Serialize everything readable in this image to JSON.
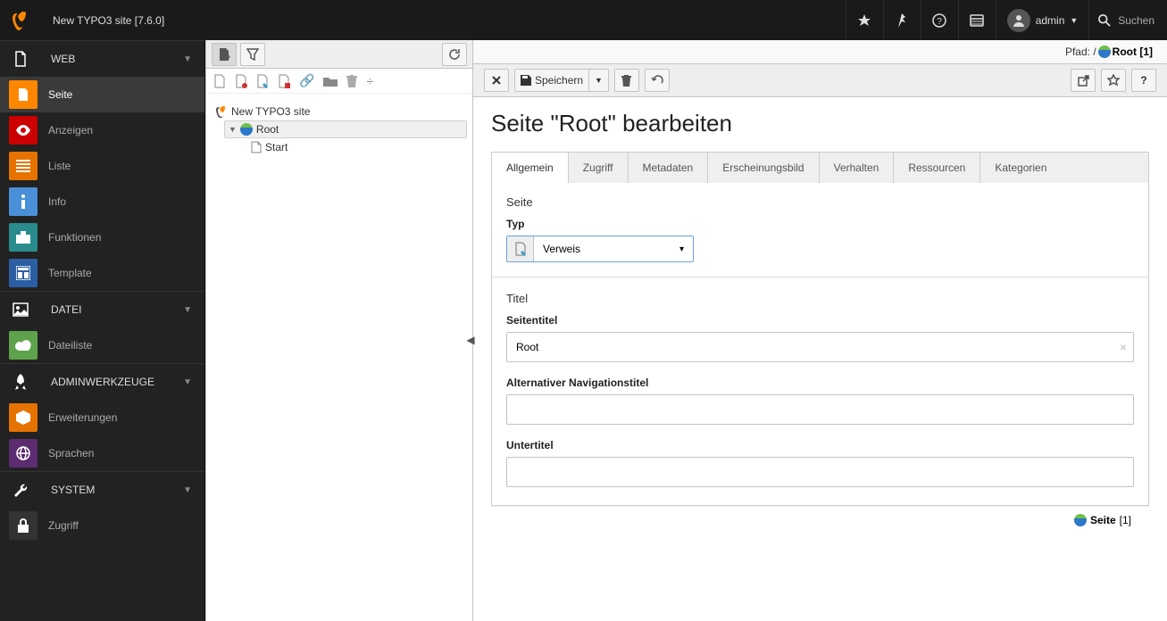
{
  "topbar": {
    "site_title": "New TYPO3 site [7.6.0]",
    "user_label": "admin",
    "search_placeholder": "Suchen"
  },
  "sidebar": {
    "groups": [
      {
        "label": "WEB",
        "items": [
          {
            "label": "Seite",
            "active": true,
            "color": "c-orange"
          },
          {
            "label": "Anzeigen",
            "color": "c-red"
          },
          {
            "label": "Liste",
            "color": "c-orange2"
          },
          {
            "label": "Info",
            "color": "c-blue"
          },
          {
            "label": "Funktionen",
            "color": "c-teal"
          },
          {
            "label": "Template",
            "color": "c-blue2"
          }
        ]
      },
      {
        "label": "DATEI",
        "items": [
          {
            "label": "Dateiliste",
            "color": "c-green"
          }
        ]
      },
      {
        "label": "ADMINWERKZEUGE",
        "items": [
          {
            "label": "Erweiterungen",
            "color": "c-orange3"
          },
          {
            "label": "Sprachen",
            "color": "c-purple"
          }
        ]
      },
      {
        "label": "SYSTEM",
        "items": [
          {
            "label": "Zugriff",
            "color": "c-dark"
          }
        ]
      }
    ]
  },
  "tree": {
    "root_label": "New TYPO3 site",
    "nodes": [
      {
        "label": "Root",
        "selected": true
      },
      {
        "label": "Start"
      }
    ]
  },
  "path": {
    "prefix": "Pfad: / ",
    "page": "Root",
    "uid": "[1]"
  },
  "toolbar": {
    "save_label": "Speichern"
  },
  "edit": {
    "heading": "Seite \"Root\" bearbeiten",
    "tabs": [
      "Allgemein",
      "Zugriff",
      "Metadaten",
      "Erscheinungsbild",
      "Verhalten",
      "Ressourcen",
      "Kategorien"
    ],
    "section_page": "Seite",
    "label_type": "Typ",
    "type_value": "Verweis",
    "section_title": "Titel",
    "label_pagetitle": "Seitentitel",
    "value_pagetitle": "Root",
    "label_navtitle": "Alternativer Navigationstitel",
    "value_navtitle": "",
    "label_subtitle": "Untertitel",
    "value_subtitle": ""
  },
  "footer": {
    "label": "Seite",
    "uid": "[1]"
  }
}
